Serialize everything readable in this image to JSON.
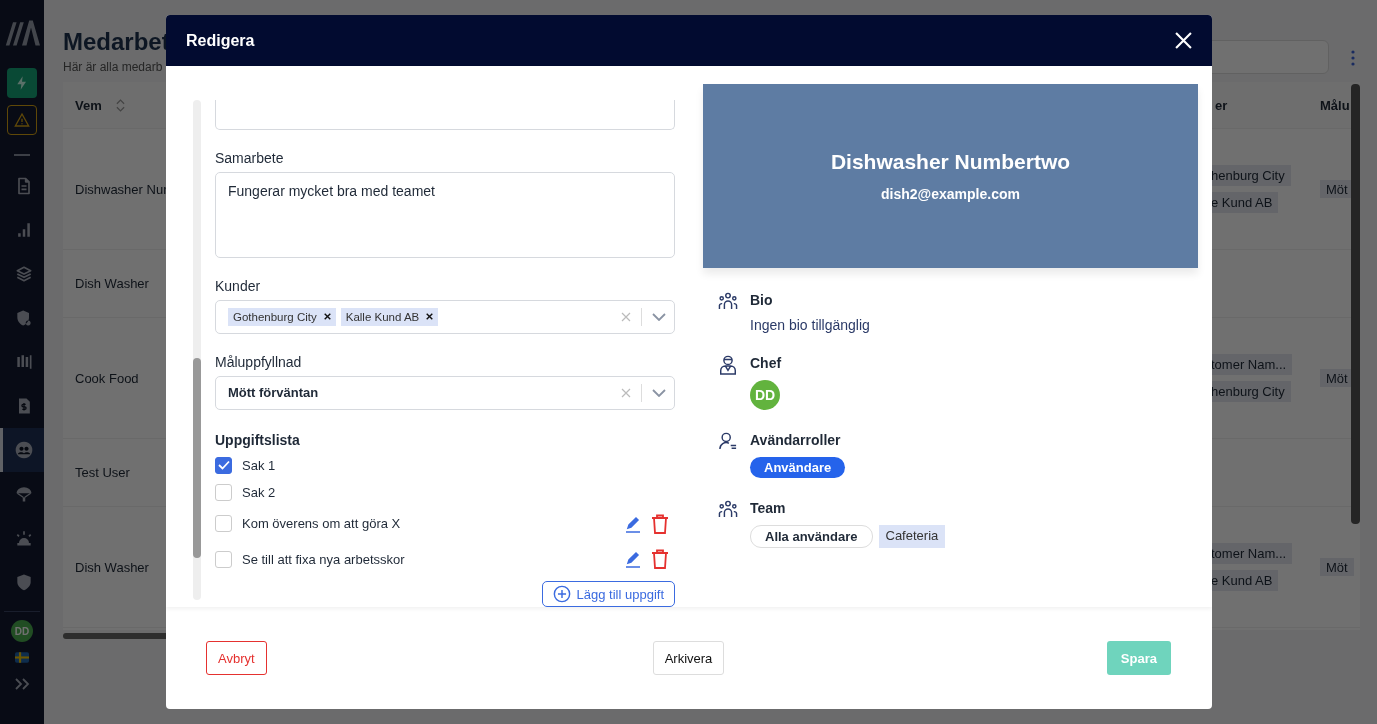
{
  "sidebar": {
    "items": [
      {
        "selected": false
      },
      {
        "selected": false
      },
      {
        "selected": false
      },
      {
        "selected": false
      },
      {
        "selected": false
      },
      {
        "selected": false
      },
      {
        "selected": true
      },
      {
        "selected": false
      },
      {
        "selected": false
      },
      {
        "selected": false
      }
    ],
    "avatar": "DD"
  },
  "page": {
    "title": "Medarbet",
    "subtitle": "Här är alla medarb",
    "columns": [
      "Vem",
      "er",
      "Målu"
    ],
    "rows": [
      {
        "name": "Dishwasher Nur",
        "customers": [
          "henburg City",
          "e Kund AB"
        ],
        "goal": "Möt"
      },
      {
        "name": "Dish Washer"
      },
      {
        "name": "Cook Food",
        "customers": [
          "tomer Nam...",
          "henburg City"
        ],
        "goal": "Möt"
      },
      {
        "name": "Test User"
      },
      {
        "name": "Dish Washer",
        "customers": [
          "tomer Nam...",
          "e Kund AB"
        ],
        "goal": "Möt"
      }
    ]
  },
  "modal": {
    "title": "Redigera",
    "fields": [
      {
        "kind": "partial"
      },
      {
        "kind": "textarea",
        "label": "Samarbete",
        "value": "Fungerar mycket bra med teamet"
      },
      {
        "kind": "multiselect",
        "label": "Kunder",
        "tags": [
          "Gothenburg City",
          "Kalle Kund AB"
        ]
      },
      {
        "kind": "select",
        "label": "Måluppfyllnad",
        "value": "Mött förväntan"
      }
    ],
    "tasks": {
      "title": "Uppgiftslista",
      "items": [
        {
          "label": "Sak 1",
          "checked": true,
          "editable": false
        },
        {
          "label": "Sak 2",
          "checked": false,
          "editable": false
        },
        {
          "label": "Kom överens om att göra X",
          "checked": false,
          "editable": true
        },
        {
          "label": "Se till att fixa nya arbetsskor",
          "checked": false,
          "editable": true
        }
      ],
      "add_button": "Lägg till uppgift"
    },
    "profile": {
      "name": "Dishwasher Numbertwo",
      "email": "dish2@example.com",
      "sections": [
        {
          "kind": "text",
          "title": "Bio",
          "text": "Ingen bio tillgänglig"
        },
        {
          "kind": "avatar",
          "title": "Chef",
          "initials": "DD"
        },
        {
          "kind": "roles",
          "title": "Avändarroller",
          "roles": [
            "Användare"
          ]
        },
        {
          "kind": "teams",
          "title": "Team",
          "teams": [
            {
              "label": "Alla användare",
              "kind": "outline"
            },
            {
              "label": "Cafeteria",
              "kind": "tag"
            }
          ]
        }
      ]
    },
    "buttons": [
      {
        "label": "Avbryt",
        "kind": "cancel",
        "disabled": false
      },
      {
        "label": "Arkivera",
        "kind": "neutral",
        "disabled": false
      },
      {
        "label": "Spara",
        "kind": "primary",
        "disabled": true
      }
    ]
  }
}
